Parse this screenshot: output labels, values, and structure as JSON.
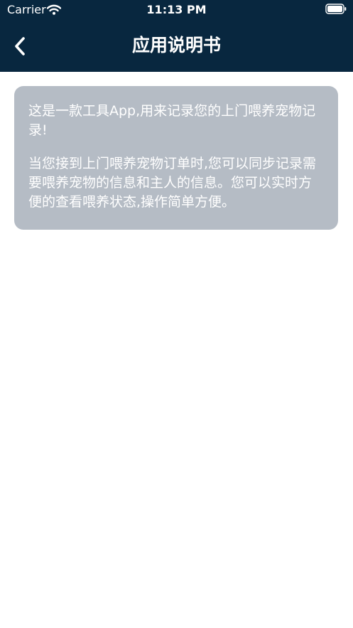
{
  "status_bar": {
    "carrier": "Carrier",
    "time": "11:13 PM",
    "wifi_icon": "wifi-icon",
    "battery_icon": "battery-icon"
  },
  "nav": {
    "title": "应用说明书",
    "back_icon": "chevron-left-icon"
  },
  "content": {
    "paragraph_1": "这是一款工具App,用来记录您的上门喂养宠物记录!",
    "paragraph_2": "当您接到上门喂养宠物订单时,您可以同步记录需要喂养宠物的信息和主人的信息。您可以实时方便的查看喂养状态,操作简单方便。"
  },
  "colors": {
    "navbar_bg": "#08273f",
    "card_bg": "#b5bcc5",
    "text_on_dark": "#ffffff",
    "page_bg": "#ffffff"
  }
}
